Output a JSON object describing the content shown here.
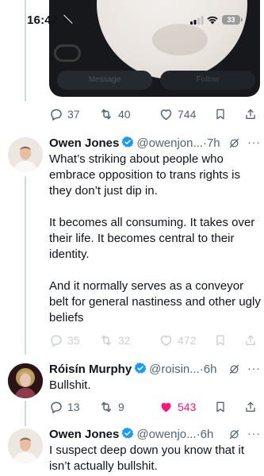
{
  "status_bar": {
    "time": "16:42",
    "battery": "33",
    "icons": [
      "bell-slash-icon",
      "signal-icon",
      "wifi-icon",
      "battery-icon"
    ]
  },
  "embedded_card": {
    "message_label": "Message",
    "follow_label": "Follow"
  },
  "tweets": [
    {
      "actions": {
        "replies": "37",
        "retweets": "40",
        "likes": "744"
      }
    },
    {
      "display_name": "Owen Jones",
      "handle": "@owenjon...",
      "separator": "·",
      "time": "7h",
      "paragraphs": [
        "What’s striking about people who embrace opposition to trans rights is they don’t just dip in.",
        "It becomes all consuming. It takes over their life. It becomes central to their identity.",
        "And it normally serves as a conveyor belt for general nastiness and other ugly beliefs"
      ],
      "actions": {
        "replies": "35",
        "retweets": "32",
        "likes": "472"
      }
    },
    {
      "display_name": "Róisín Murphy",
      "handle": "@roisin...",
      "separator": "·",
      "time": "6h",
      "paragraphs": [
        "Bullshit."
      ],
      "actions": {
        "replies": "13",
        "retweets": "9",
        "likes": "543"
      },
      "liked": true
    },
    {
      "display_name": "Owen Jones",
      "handle": "@owenjo...",
      "separator": "·",
      "time": "6h",
      "paragraphs": [
        "I suspect deep down you know that it isn’t actually bullshit."
      ]
    }
  ],
  "colors": {
    "verified": "#1d9bf0",
    "like_active": "#f91880",
    "secondary_text": "#536471"
  },
  "more_label": "···"
}
